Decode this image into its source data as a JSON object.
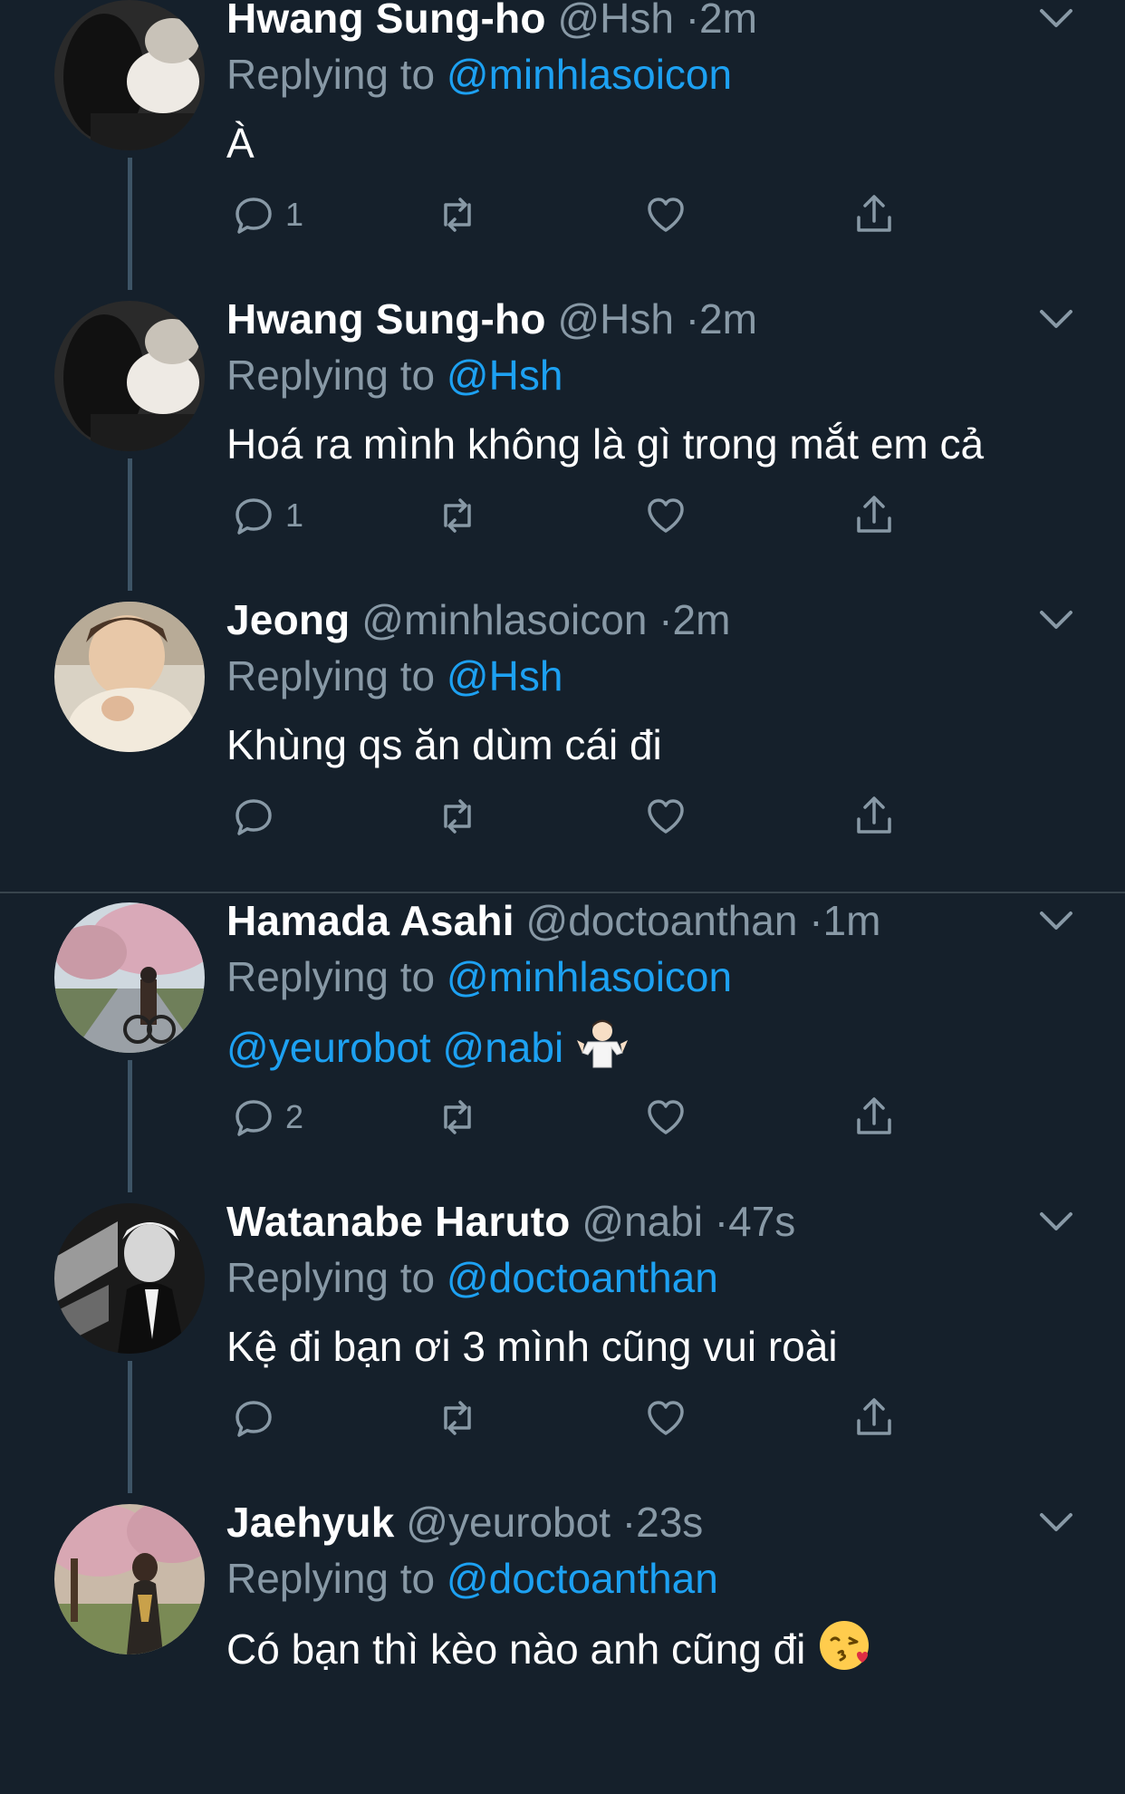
{
  "colors": {
    "background": "#15202b",
    "text_primary": "#ffffff",
    "text_secondary": "#8899a6",
    "link": "#1da1f2",
    "divider": "#38444d",
    "thread_line": "#3d5466"
  },
  "tweets": [
    {
      "name": "Hwang Sung-ho",
      "handle": "@Hsh",
      "time": "2m",
      "dot": "·",
      "reply_label": "Replying to",
      "reply_to": "@minhlasoicon",
      "text": "À",
      "reply_count": "1",
      "avatar_icon": "profile-photo"
    },
    {
      "name": "Hwang Sung-ho",
      "handle": "@Hsh",
      "time": "2m",
      "dot": "·",
      "reply_label": "Replying to",
      "reply_to": "@Hsh",
      "text": "Hoá ra mình không là gì trong mắt em cả",
      "reply_count": "1",
      "avatar_icon": "profile-photo"
    },
    {
      "name": "Jeong",
      "handle": "@minhlasoicon",
      "time": "2m",
      "dot": "·",
      "reply_label": "Replying to",
      "reply_to": "@Hsh",
      "text": "Khùng qs ăn dùm cái đi",
      "reply_count": "",
      "avatar_icon": "profile-photo"
    },
    {
      "name": "Hamada Asahi",
      "handle": "@doctoanthan",
      "time": "1m",
      "dot": "·",
      "reply_label": "Replying to",
      "reply_to": "@minhlasoicon",
      "mentions": [
        "@yeurobot",
        "@nabi"
      ],
      "emoji": "person-shrugging-emoji",
      "reply_count": "2",
      "avatar_icon": "profile-photo"
    },
    {
      "name": "Watanabe Haruto",
      "handle": "@nabi",
      "time": "47s",
      "dot": "·",
      "reply_label": "Replying to",
      "reply_to": "@doctoanthan",
      "text": "Kệ đi bạn ơi 3 mình cũng vui roài",
      "reply_count": "",
      "avatar_icon": "profile-photo"
    },
    {
      "name": "Jaehyuk",
      "handle": "@yeurobot",
      "time": "23s",
      "dot": "·",
      "reply_label": "Replying to",
      "reply_to": "@doctoanthan",
      "text": "Có bạn thì kèo nào anh cũng đi",
      "emoji": "face-blowing-kiss-emoji",
      "reply_count": "",
      "avatar_icon": "profile-photo"
    }
  ],
  "icons": {
    "reply": "reply-icon",
    "retweet": "retweet-icon",
    "like": "heart-icon",
    "share": "share-icon",
    "menu": "chevron-down-icon"
  }
}
